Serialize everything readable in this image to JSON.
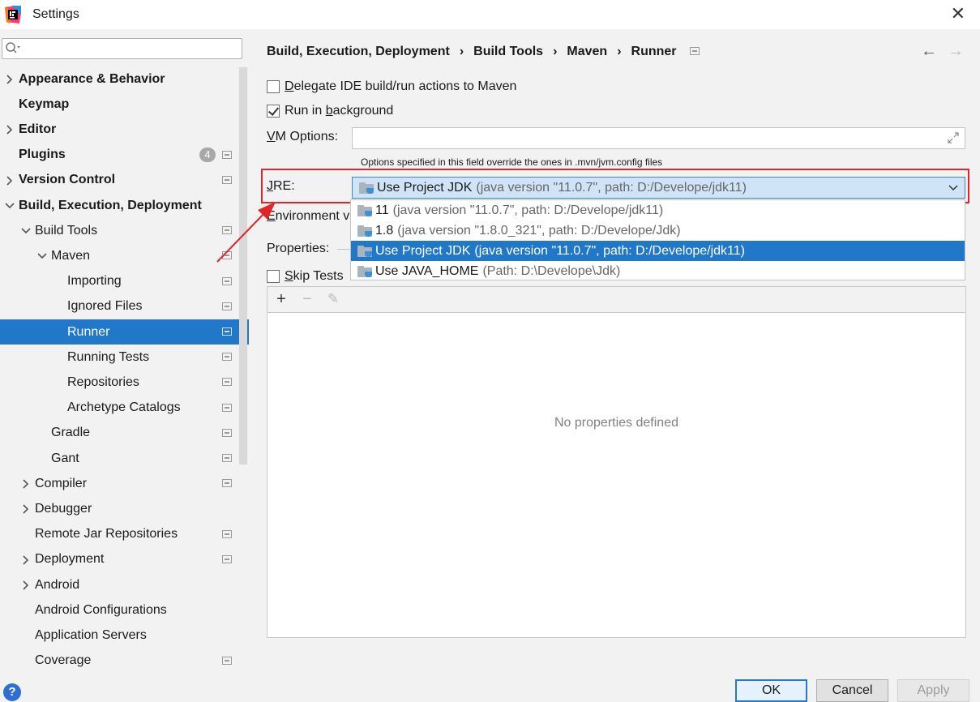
{
  "window": {
    "title": "Settings",
    "close_glyph": "✕",
    "accent_color": "#2178c8",
    "highlight_color": "#e0262b"
  },
  "sidebar": {
    "search_placeholder": "",
    "items": [
      {
        "label": "Appearance & Behavior",
        "bold": true,
        "chevron": "right"
      },
      {
        "label": "Keymap",
        "bold": true
      },
      {
        "label": "Editor",
        "bold": true,
        "chevron": "right"
      },
      {
        "label": "Plugins",
        "bold": true,
        "badge": "4"
      },
      {
        "label": "Version Control",
        "bold": true,
        "chevron": "right"
      },
      {
        "label": "Build, Execution, Deployment",
        "bold": true,
        "chevron": "down"
      },
      {
        "label": "Build Tools",
        "chevron": "down"
      },
      {
        "label": "Maven",
        "chevron": "down"
      },
      {
        "label": "Importing"
      },
      {
        "label": "Ignored Files"
      },
      {
        "label": "Runner",
        "selected": true
      },
      {
        "label": "Running Tests"
      },
      {
        "label": "Repositories"
      },
      {
        "label": "Archetype Catalogs"
      },
      {
        "label": "Gradle"
      },
      {
        "label": "Gant"
      },
      {
        "label": "Compiler",
        "chevron": "right"
      },
      {
        "label": "Debugger",
        "chevron": "right"
      },
      {
        "label": "Remote Jar Repositories"
      },
      {
        "label": "Deployment",
        "chevron": "right"
      },
      {
        "label": "Android",
        "chevron": "right"
      },
      {
        "label": "Android Configurations"
      },
      {
        "label": "Application Servers"
      },
      {
        "label": "Coverage"
      }
    ]
  },
  "breadcrumb": {
    "parts": [
      "Build, Execution, Deployment",
      "Build Tools",
      "Maven",
      "Runner"
    ],
    "separator": "›"
  },
  "nav": {
    "back": "←",
    "forward": "→"
  },
  "options": {
    "delegate_label_underlined": "D",
    "delegate_label_rest": "elegate IDE build/run actions to Maven",
    "delegate_checked": false,
    "background_label_pre": "Run in ",
    "background_label_underlined": "b",
    "background_label_rest": "ackground",
    "background_checked": true,
    "vm_label_underlined": "V",
    "vm_label_rest": "M Options:",
    "vm_value": "",
    "vm_hint": "Options specified in this field override the ones in .mvn/jvm.config files",
    "jre_label_underlined": "J",
    "jre_label_rest": "RE:",
    "jre_selected_main": "Use Project JDK",
    "jre_selected_detail": "(java version \"11.0.7\", path: D:/Develope/jdk11)",
    "env_label_underlined": "E",
    "env_label_rest": "nvironment v",
    "properties_label": "Properties:",
    "skip_label_underlined": "S",
    "skip_label_rest": "kip Tests",
    "skip_checked": false
  },
  "jre_dropdown": [
    {
      "main": "11",
      "detail": "(java version \"11.0.7\", path: D:/Develope/jdk11)"
    },
    {
      "main": "1.8",
      "detail": "(java version \"1.8.0_321\", path: D:/Develope/Jdk)"
    },
    {
      "main": "Use Project JDK",
      "detail": "(java version \"11.0.7\", path: D:/Develope/jdk11)",
      "selected": true
    },
    {
      "main": "Use JAVA_HOME",
      "detail": "(Path: D:\\Develope\\Jdk)"
    }
  ],
  "properties_toolbar": {
    "add": "+",
    "remove": "−",
    "edit": "✎"
  },
  "properties_empty": "No properties defined",
  "buttons": {
    "ok": "OK",
    "cancel": "Cancel",
    "apply": "Apply",
    "help": "?"
  }
}
